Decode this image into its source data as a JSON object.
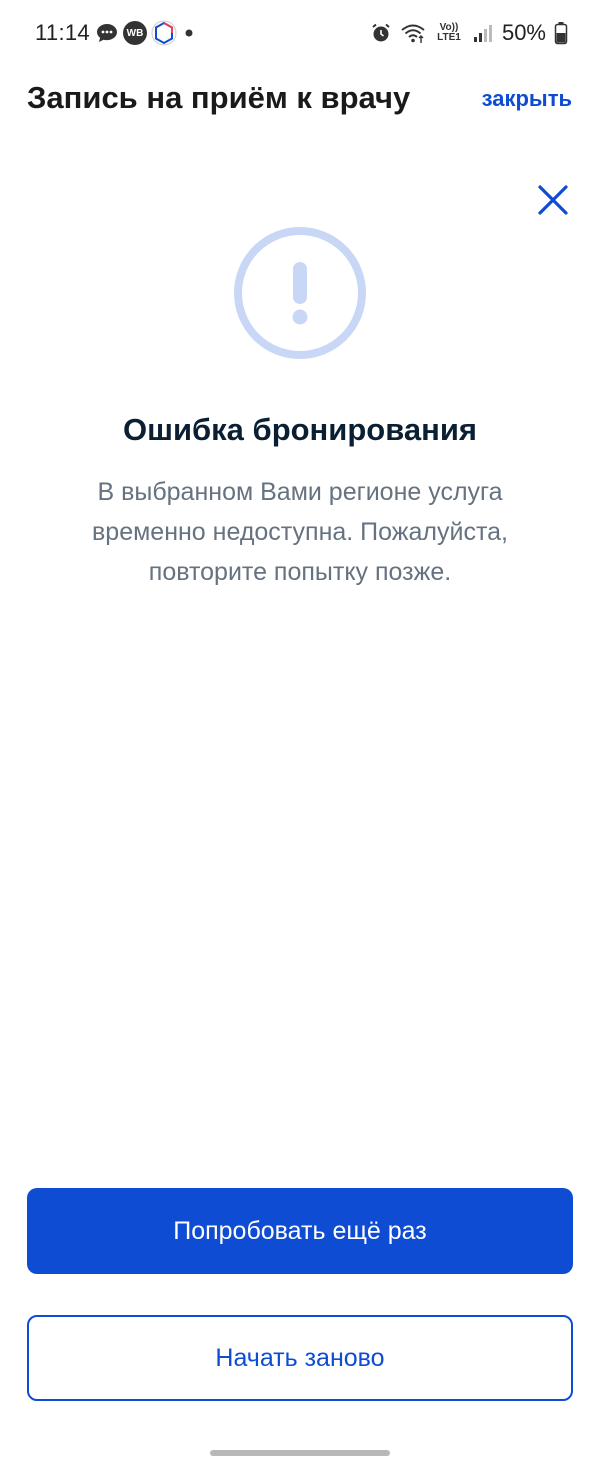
{
  "status_bar": {
    "time": "11:14",
    "battery": "50%",
    "icons_left": [
      "chat-bubble-icon",
      "wb-app-icon",
      "gosuslugi-app-icon",
      "dot-icon"
    ],
    "icons_right": [
      "alarm-icon",
      "wifi-icon",
      "volte-icon",
      "signal-icon",
      "battery-icon"
    ],
    "wb_label": "WB",
    "volte_label": "Vo)) LTE1"
  },
  "header": {
    "title": "Запись на приём к врачу",
    "close_label": "закрыть"
  },
  "error": {
    "icon": "exclamation-circle-icon",
    "title": "Ошибка бронирования",
    "message": "В выбранном Вами регионе услуга временно недоступна. Пожалуйста, повторите попытку позже."
  },
  "actions": {
    "retry_label": "Попробовать ещё раз",
    "restart_label": "Начать заново"
  },
  "colors": {
    "primary": "#0d4cd3",
    "icon_light": "#c9d7f7",
    "text_dark": "#0b1f33",
    "text_muted": "#66727f"
  }
}
